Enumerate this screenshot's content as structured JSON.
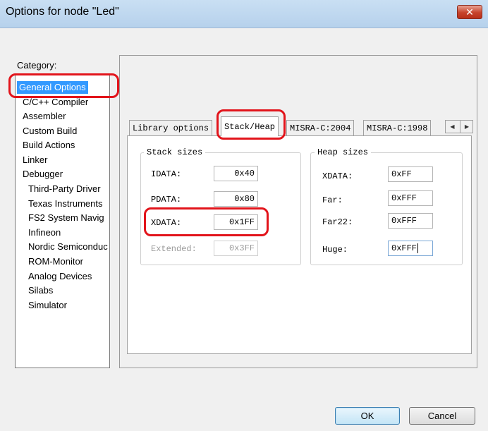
{
  "window": {
    "title": "Options for node \"Led\"",
    "close_glyph": "✕"
  },
  "category": {
    "label": "Category:",
    "items": [
      {
        "label": "General Options",
        "selected": true
      },
      {
        "label": "C/C++ Compiler"
      },
      {
        "label": "Assembler"
      },
      {
        "label": "Custom Build"
      },
      {
        "label": "Build Actions"
      },
      {
        "label": "Linker"
      },
      {
        "label": "Debugger"
      },
      {
        "label": "Third-Party Driver"
      },
      {
        "label": "Texas Instruments"
      },
      {
        "label": "FS2 System Navig"
      },
      {
        "label": "Infineon"
      },
      {
        "label": "Nordic Semiconduc"
      },
      {
        "label": "ROM-Monitor"
      },
      {
        "label": "Analog Devices"
      },
      {
        "label": "Silabs"
      },
      {
        "label": "Simulator"
      }
    ]
  },
  "tabs": [
    {
      "label": "Library options"
    },
    {
      "label": "Stack/Heap",
      "active": true
    },
    {
      "label": "MISRA-C:2004"
    },
    {
      "label": "MISRA-C:1998"
    }
  ],
  "tab_scroll": {
    "left_glyph": "◀",
    "right_glyph": "▶"
  },
  "stack": {
    "title": "Stack sizes",
    "idata_label": "IDATA:",
    "idata_value": "0x40",
    "pdata_label": "PDATA:",
    "pdata_value": "0x80",
    "xdata_label": "XDATA:",
    "xdata_value": "0x1FF",
    "extended_label": "Extended:",
    "extended_value": "0x3FF"
  },
  "heap": {
    "title": "Heap sizes",
    "xdata_label": "XDATA:",
    "xdata_value": "0xFF",
    "far_label": "Far:",
    "far_value": "0xFFF",
    "far22_label": "Far22:",
    "far22_value": "0xFFF",
    "huge_label": "Huge:",
    "huge_value": "0xFFF"
  },
  "buttons": {
    "ok": "OK",
    "cancel": "Cancel"
  },
  "colors": {
    "highlight_ring": "#e2141b",
    "selection": "#3399ff"
  }
}
